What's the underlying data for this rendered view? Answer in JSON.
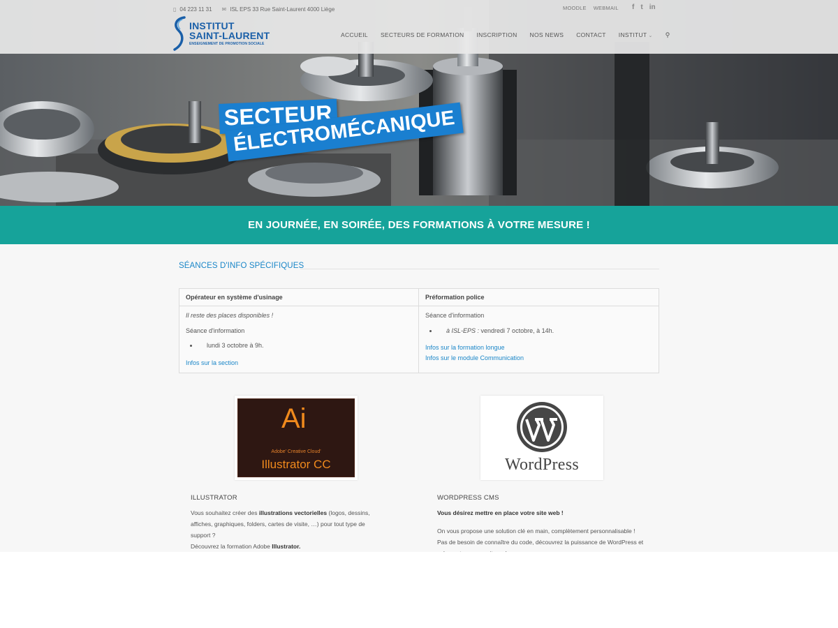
{
  "topbar": {
    "phone": "04 223 11 31",
    "address": "ISL EPS 33 Rue Saint-Laurent 4000 Liège",
    "links": [
      "MOODLE",
      "WEBMAIL"
    ],
    "social": [
      {
        "icon": "facebook-icon",
        "glyph": "f"
      },
      {
        "icon": "twitter-icon",
        "glyph": "t"
      },
      {
        "icon": "linkedin-icon",
        "glyph": "in"
      }
    ]
  },
  "logo": {
    "line1": "INSTITUT",
    "line2": "SAINT-LAURENT",
    "line3": "ENSEIGNEMENT DE PROMOTION SOCIALE"
  },
  "nav": {
    "items": [
      "ACCUEIL",
      "SECTEURS DE FORMATION",
      "INSCRIPTION",
      "NOS NEWS",
      "CONTACT",
      "INSTITUT"
    ],
    "dropdown_item": "INSTITUT",
    "search_icon": "search-icon"
  },
  "hero": {
    "label1": "SECTEUR",
    "label2": "ÉLECTROMÉCANIQUE"
  },
  "band": {
    "text": "EN JOURNÉE, EN SOIRÉE, DES FORMATIONS À VOTRE MESURE !"
  },
  "info": {
    "title": "SÉANCES D'INFO SPÉCIFIQUES",
    "col1": {
      "header": "Opérateur en système d'usinage",
      "note": "Il reste des places disponibles !",
      "subtitle": "Séance d'information",
      "date": "lundi 3 octobre à 9h.",
      "link": "Infos sur la section"
    },
    "col2": {
      "header": "Préformation police",
      "subtitle": "Séance d'information",
      "date_place": "à ISL-EPS :",
      "date": " vendredi 7 octobre, à 14h.",
      "link1": "Infos sur la formation longue",
      "link2": "Infos sur le module Communication"
    }
  },
  "cards": {
    "illustrator": {
      "logo_big": "Ai",
      "logo_small": "Adobe' Creative Cloud'",
      "logo_name": "Illustrator CC",
      "title": "ILLUSTRATOR",
      "t1": "Vous souhaitez créer des ",
      "t1b": "illustrations vectorielles",
      "t2": " (logos, dessins, affiches, graphiques, folders, cartes de visite, …) pour tout type de support ?",
      "t3": "Découvrez la formation Adobe ",
      "t3b": "Illustrator."
    },
    "wordpress": {
      "logo_word": "WordPress",
      "title": "WORDPRESS CMS",
      "lead": "Vous désirez mettre en place votre site web !",
      "text": "On vous propose une solution clé en main, complètement personnalisable ! Pas de besoin de connaître du code, découvrez la puissance de WordPress et créez votre propre site web."
    }
  },
  "colors": {
    "accent": "#1a86c8",
    "label_blue": "#1a7fd0",
    "band_teal": "#16a39a",
    "logo_blue": "#1a5fa8"
  }
}
